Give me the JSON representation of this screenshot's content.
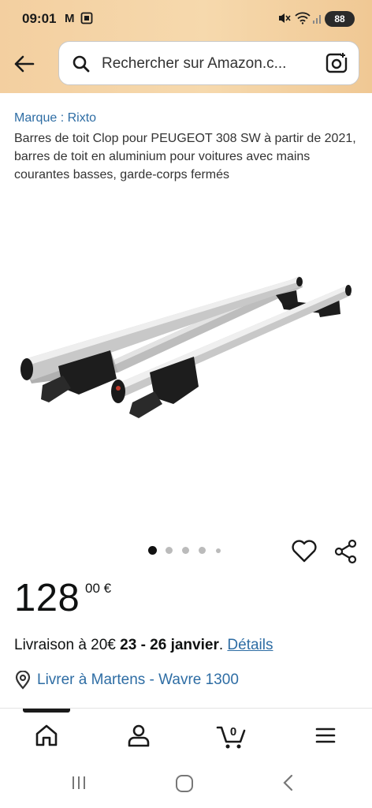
{
  "status_bar": {
    "time": "09:01",
    "carrier": "M",
    "battery": "88"
  },
  "search": {
    "placeholder": "Rechercher sur Amazon.c..."
  },
  "product": {
    "brand": "Marque : Rixto",
    "title": "Barres de toit Clop pour PEUGEOT 308 SW à partir de 2021, barres de toit en aluminium pour voitures avec mains courantes basses, garde-corps fermés",
    "image_count": 5,
    "active_image": 1
  },
  "price": {
    "whole": "128",
    "fraction": "00 €"
  },
  "delivery": {
    "prefix": "Livraison à 20€ ",
    "dates": "23 - 26 janvier",
    "separator": ". ",
    "details_link": "Détails"
  },
  "location": {
    "text": "Livrer à Martens - Wavre 1300"
  },
  "tab_bar": {
    "cart_count": "0"
  },
  "colors": {
    "link": "#2e6da4",
    "header_bg": "#f3cfa0"
  }
}
